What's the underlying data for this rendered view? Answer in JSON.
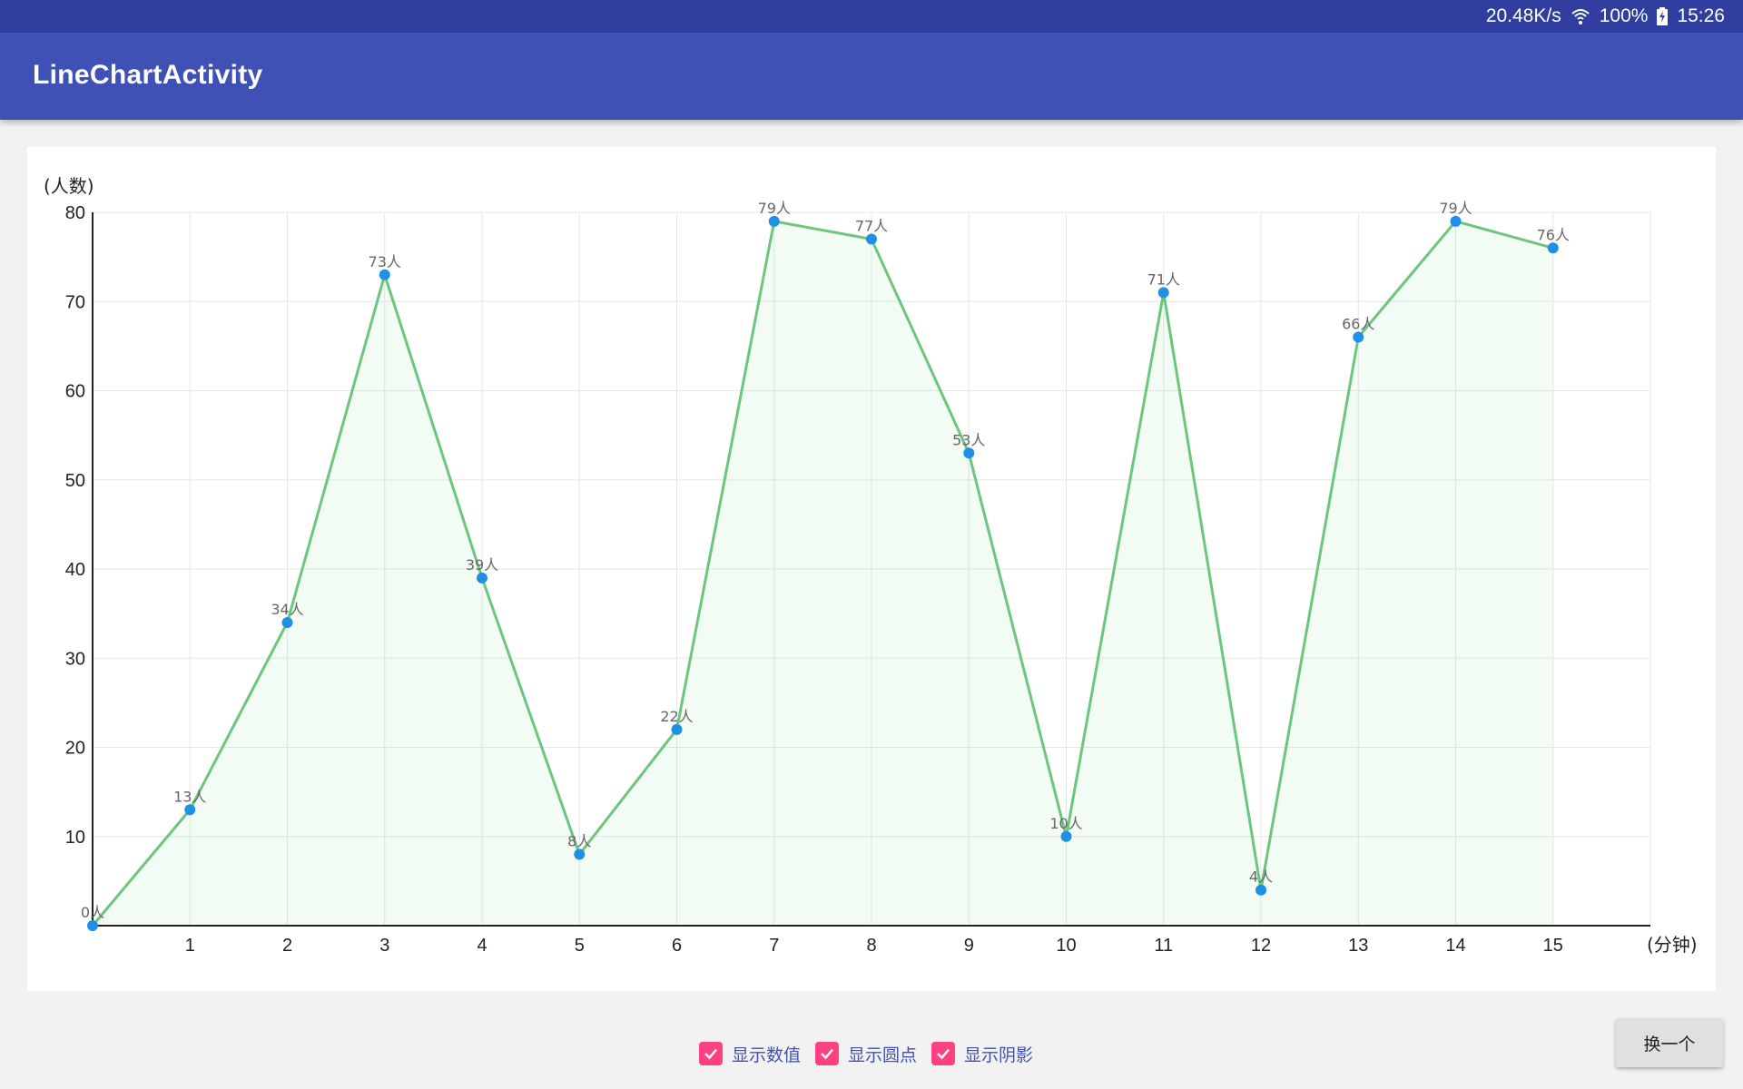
{
  "status_bar": {
    "net_speed": "20.48K/s",
    "battery": "100%",
    "time": "15:26",
    "icons": [
      "wifi-icon",
      "battery-charging-icon"
    ]
  },
  "app_bar": {
    "title": "LineChartActivity"
  },
  "chart_data": {
    "type": "area",
    "x": [
      0,
      1,
      2,
      3,
      4,
      5,
      6,
      7,
      8,
      9,
      10,
      11,
      12,
      13,
      14,
      15
    ],
    "values": [
      0,
      13,
      34,
      73,
      39,
      8,
      22,
      79,
      77,
      53,
      10,
      71,
      4,
      66,
      79,
      76
    ],
    "point_label_suffix": "人",
    "x_tick_labels": [
      "1",
      "2",
      "3",
      "4",
      "5",
      "6",
      "7",
      "8",
      "9",
      "10",
      "11",
      "12",
      "13",
      "14",
      "15"
    ],
    "y_tick_labels": [
      "10",
      "20",
      "30",
      "40",
      "50",
      "60",
      "70",
      "80"
    ],
    "ylabel": "(人数)",
    "xlabel": "(分钟)",
    "xlim": [
      0,
      16
    ],
    "ylim": [
      0,
      80
    ],
    "grid": true,
    "show_values": true,
    "show_points": true,
    "show_fill": true,
    "colors": {
      "line": "#6cc67d",
      "point": "#1e90e6",
      "fill": "#6cc67d",
      "grid": "#e6e6e6",
      "axis": "#222222"
    }
  },
  "options": [
    {
      "label": "显示数值",
      "checked": true
    },
    {
      "label": "显示圆点",
      "checked": true
    },
    {
      "label": "显示阴影",
      "checked": true
    }
  ],
  "refresh_button": {
    "label": "换一个"
  }
}
